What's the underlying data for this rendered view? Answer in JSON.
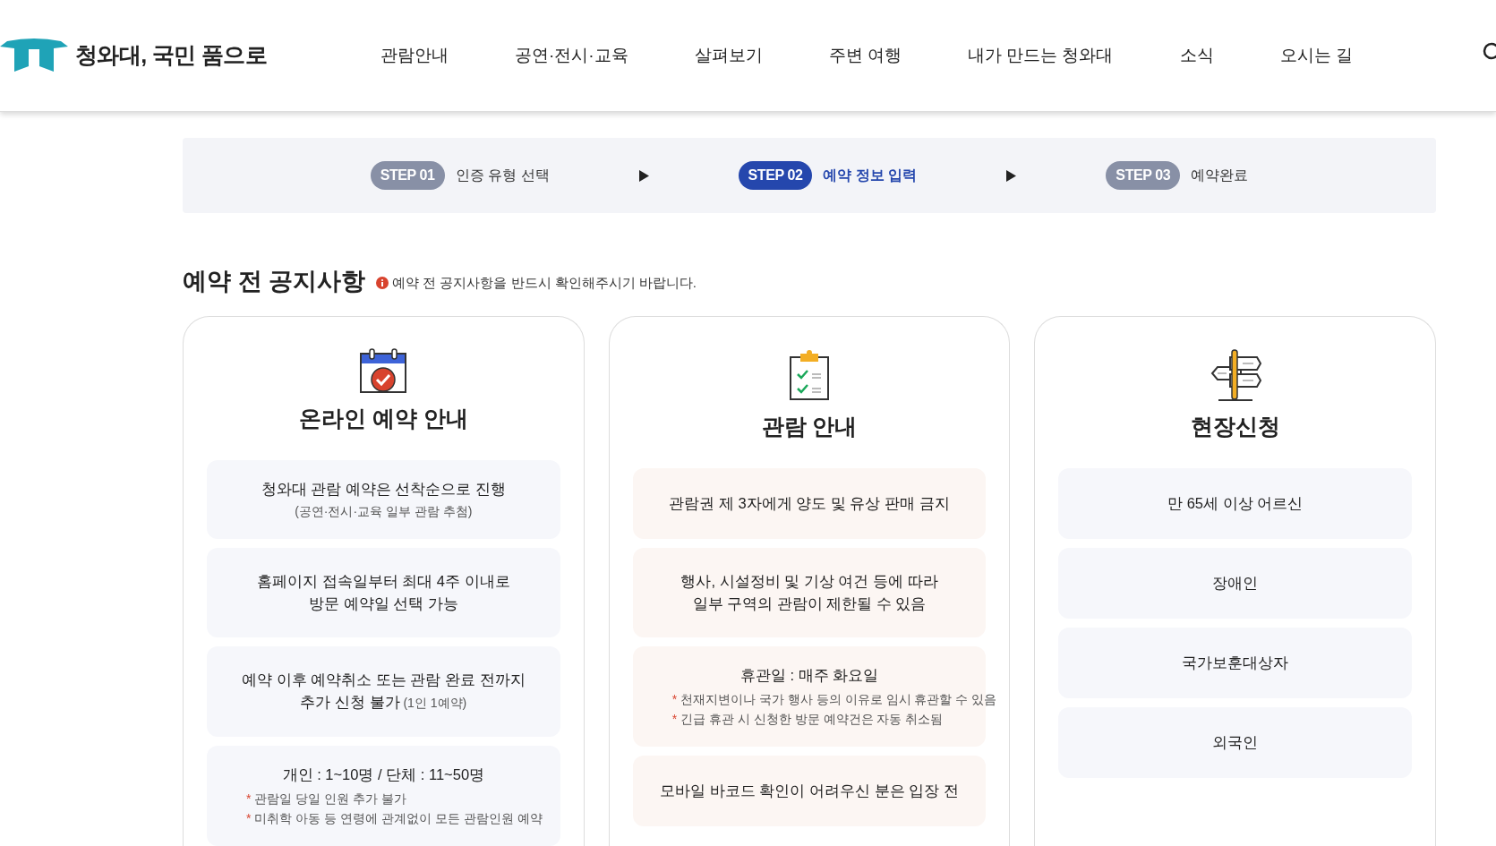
{
  "header": {
    "logo_text": "청와대, 국민 품으로",
    "nav": [
      {
        "label": "관람안내"
      },
      {
        "label": "공연·전시·교육"
      },
      {
        "label": "살펴보기"
      },
      {
        "label": "주변 여행"
      },
      {
        "label": "내가 만드는 청와대"
      },
      {
        "label": "소식"
      },
      {
        "label": "오시는 길"
      }
    ]
  },
  "steps": [
    {
      "badge": "STEP 01",
      "label": "인증 유형 선택",
      "selected": false
    },
    {
      "badge": "STEP 02",
      "label": "예약 정보 입력",
      "selected": true
    },
    {
      "badge": "STEP 03",
      "label": "예약완료",
      "selected": false
    }
  ],
  "notice": {
    "title": "예약 전 공지사항",
    "hint": "예약 전 공지사항을 반드시 확인해주시기 바랍니다."
  },
  "cards": [
    {
      "kind": "calendar",
      "title": "온라인 예약 안내",
      "items": [
        {
          "lines": [
            "청와대 관람 예약은 선착순으로 진행"
          ],
          "sub": "(공연·전시·교육 일부 관람 추첨)"
        },
        {
          "lines": [
            "홈페이지 접속일부터 최대 4주 이내로",
            "방문 예약일 선택 가능"
          ]
        },
        {
          "lines": [
            "예약 이후 예약취소 또는 관람 완료 전까지",
            "추가 신청 불가"
          ],
          "aside": "(1인 1예약)"
        },
        {
          "lines": [
            "개인 : 1~10명 / 단체 : 11~50명"
          ],
          "notes": [
            {
              "mark": "*",
              "text": "관람일 당일 인원 추가 불가"
            },
            {
              "mark": "*",
              "text": "미취학 아동 등 연령에 관계없이 모든 관람인원 예약"
            }
          ]
        }
      ]
    },
    {
      "kind": "clipboard",
      "title": "관람 안내",
      "items": [
        {
          "lines": [
            "관람권 제 3자에게 양도 및 유상 판매 금지"
          ]
        },
        {
          "lines": [
            "행사, 시설정비 및 기상 여건 등에 따라",
            "일부 구역의 관람이 제한될 수 있음"
          ]
        },
        {
          "lines": [
            "휴관일 : 매주 화요일"
          ],
          "notes": [
            {
              "mark": "*",
              "text": "천재지변이나 국가 행사 등의 이유로 임시 휴관할 수 있음"
            },
            {
              "mark": "*",
              "text": "긴급 휴관 시 신청한 방문 예약건은 자동 취소됨"
            }
          ]
        },
        {
          "lines": [
            "모바일 바코드 확인이 어려우신 분은 입장 전"
          ]
        }
      ]
    },
    {
      "kind": "signpost",
      "title": "현장신청",
      "items": [
        {
          "lines": [
            "만 65세 이상 어르신"
          ]
        },
        {
          "lines": [
            "장애인"
          ]
        },
        {
          "lines": [
            "국가보훈대상자"
          ]
        },
        {
          "lines": [
            "외국인"
          ]
        }
      ]
    }
  ]
}
